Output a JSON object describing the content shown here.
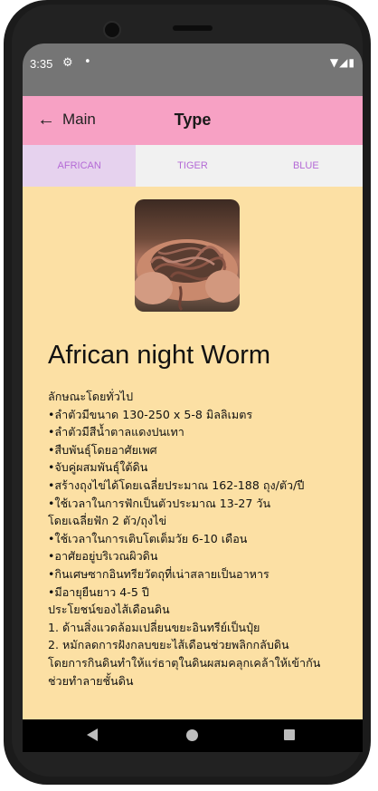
{
  "status_bar": {
    "time": "3:35",
    "icons": [
      "gear-icon",
      "dot-icon",
      "wifi-icon",
      "signal-icon",
      "battery-icon"
    ]
  },
  "app_bar": {
    "back_label": "Main",
    "title": "Type"
  },
  "tabs": [
    {
      "label": "AFRICAN",
      "active": true
    },
    {
      "label": "TIGER",
      "active": false
    },
    {
      "label": "BLUE",
      "active": false
    }
  ],
  "content": {
    "heading": "African night Worm",
    "lines": [
      "ลักษณะโดยทั่วไป",
      "•ลำตัวมีขนาด 130-250 x 5-8 มิลลิเมตร",
      "•ลำตัวมีสีน้ำตาลแดงปนเทา",
      "•สืบพันธุ์โดยอาศัยเพศ",
      "•จับคู่ผสมพันธุ์ใต้ดิน",
      "•สร้างถุงไข่ได้โดยเฉลี่ยประมาณ 162-188 ถุง/ตัว/ปี",
      "•ใช้เวลาในการฟักเป็นตัวประมาณ 13-27 วัน",
      "โดยเฉลี่ยฟัก 2 ตัว/ถุงไข่",
      "•ใช้เวลาในการเติบโตเต็มวัย 6-10 เดือน",
      "•อาศัยอยู่บริเวณผิวดิน",
      "•กินเศษซากอินทรียวัตถุที่เน่าสลายเป็นอาหาร",
      "•มีอายุยืนยาว 4-5 ปี",
      "ประโยชน์ของไส้เดือนดิน",
      "1. ด้านสิ่งแวดล้อมเปลี่ยนขยะอินทรีย์เป็นปุ๋ย",
      "2. หมักลดการฝังกลบขยะไส้เดือนช่วยพลิกกลับดิน",
      "โดยการกินดินทำให้แร่ธาตุในดินผสมคลุกเคล้าให้เข้ากัน",
      "ช่วยทำลายชั้นดิน"
    ]
  },
  "colors": {
    "app_bar": "#f7a1c4",
    "tab_text": "#b46ad6",
    "active_tab_bg": "#e6d2ee",
    "content_bg": "#fce0a4",
    "status_bar": "#757575"
  }
}
